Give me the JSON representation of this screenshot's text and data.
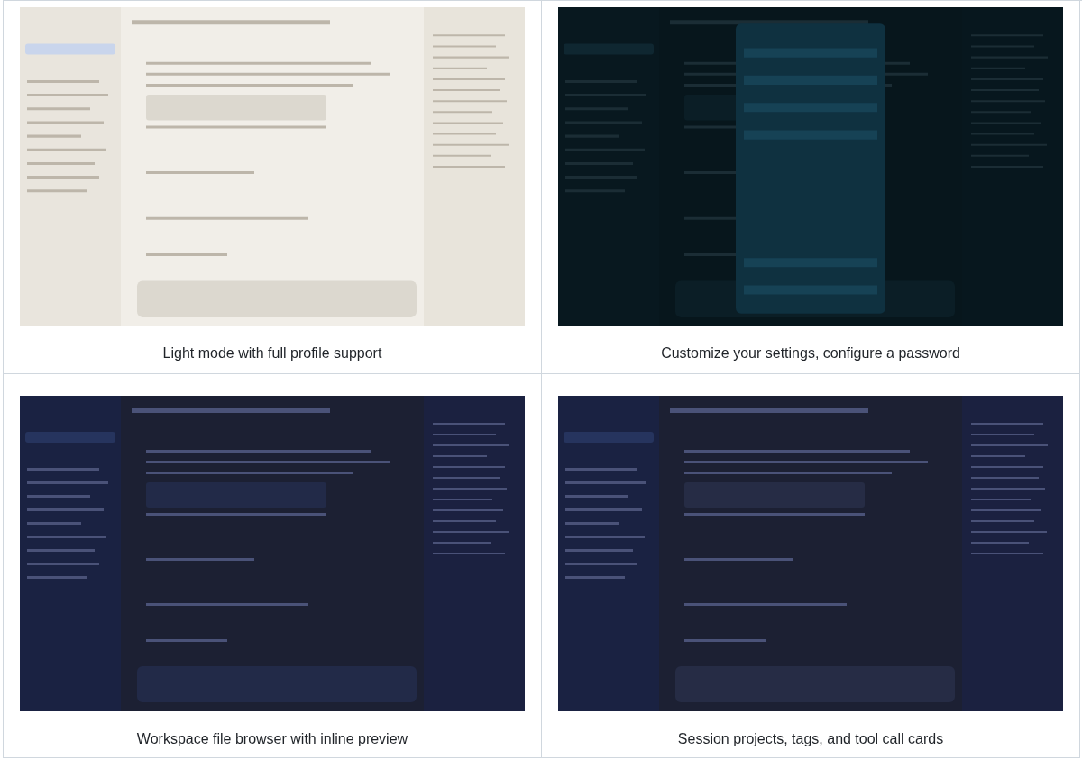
{
  "panels": [
    {
      "kind": "picture",
      "caption": "Light mode with full profile support"
    },
    {
      "kind": "picture",
      "caption": "Customize your settings, configure a password"
    },
    {
      "kind": "picture",
      "caption": "Workspace file browser with inline preview"
    },
    {
      "kind": "picture",
      "caption": "Session projects, tags, and tool call cards"
    }
  ]
}
